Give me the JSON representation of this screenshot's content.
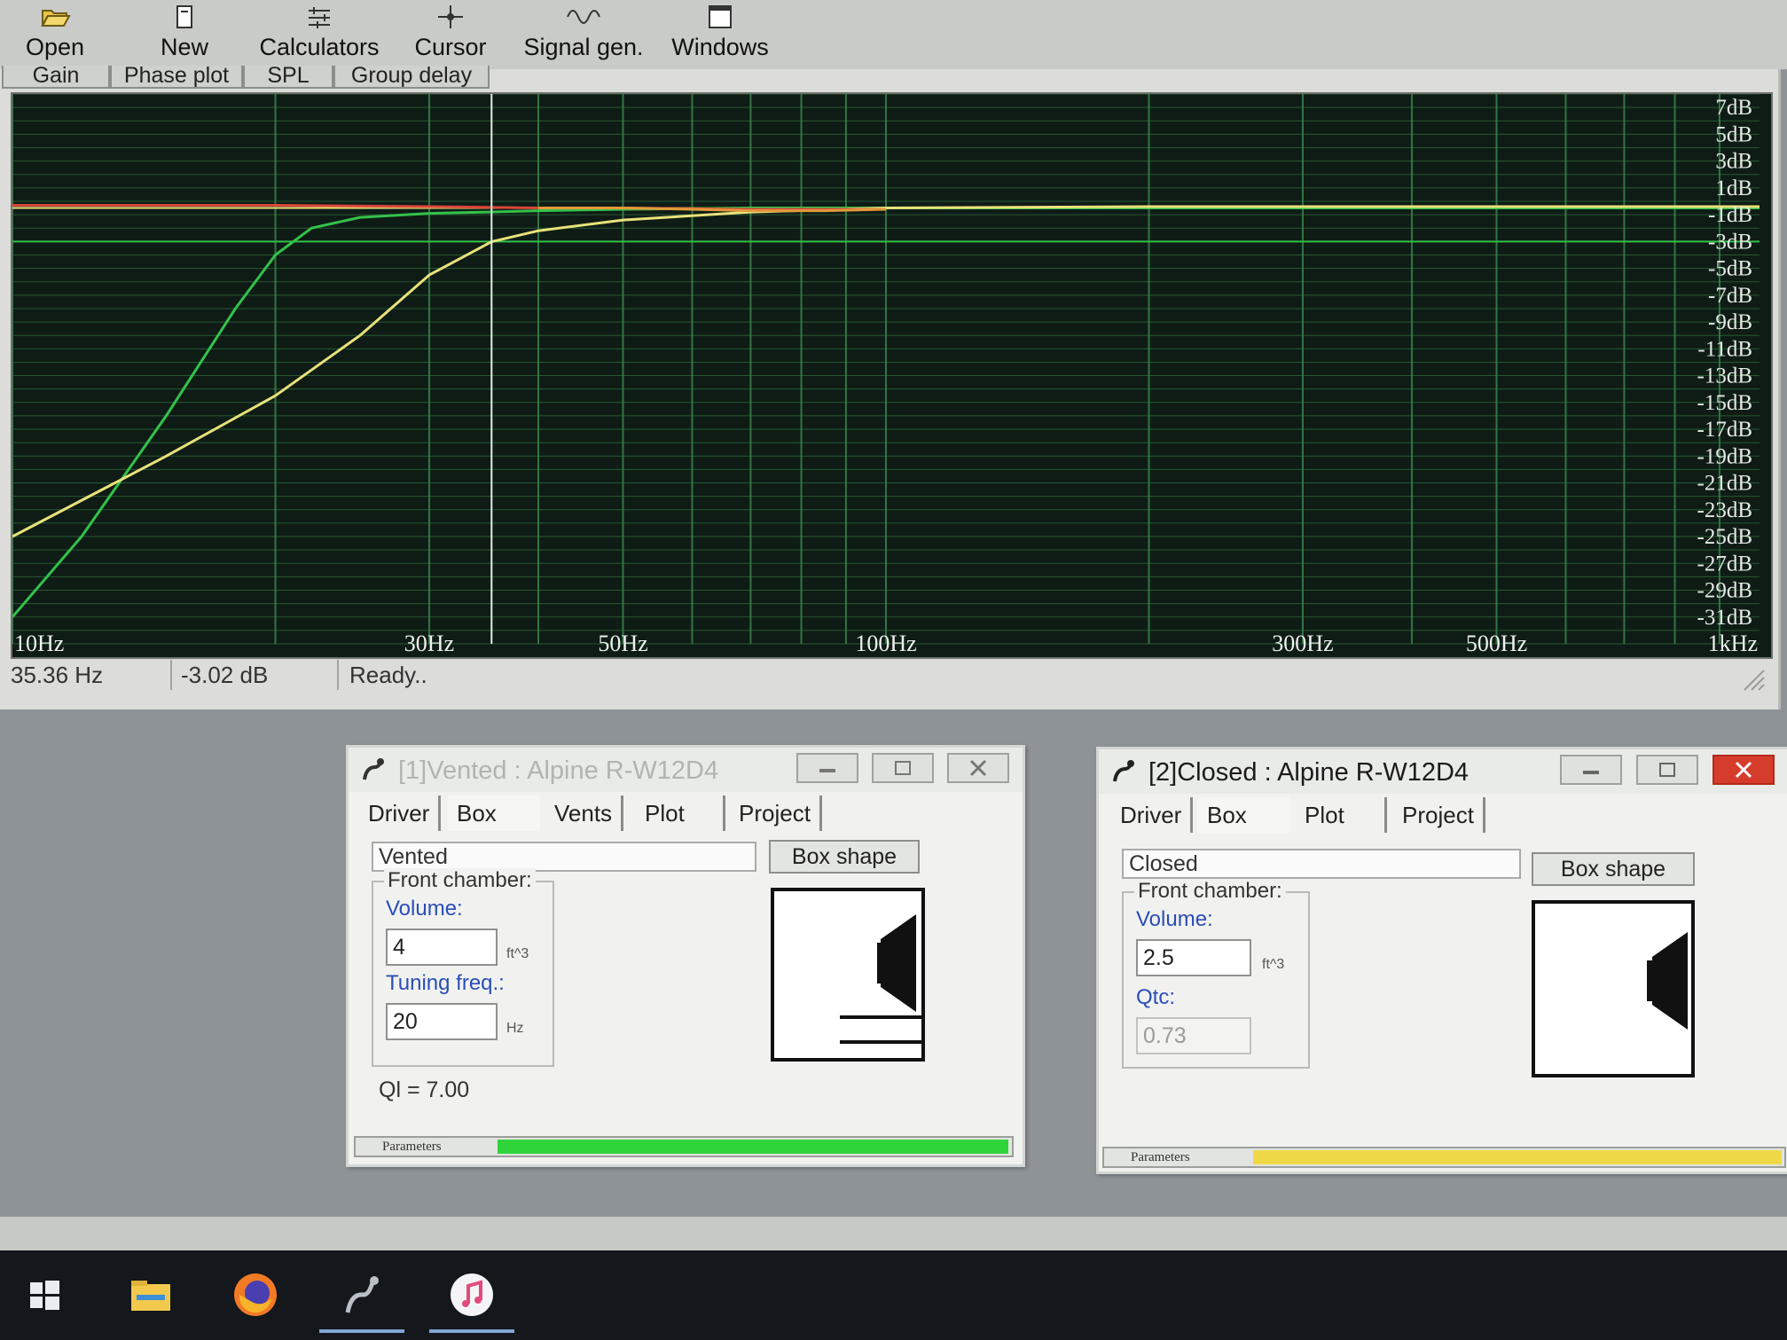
{
  "toolbar": {
    "open": "Open",
    "new": "New",
    "calculators": "Calculators",
    "cursor": "Cursor",
    "signal_gen": "Signal gen.",
    "windows": "Windows"
  },
  "plot_tabs": [
    "Gain",
    "Phase plot",
    "SPL",
    "Group delay"
  ],
  "graph": {
    "y_labels": [
      "7dB",
      "5dB",
      "3dB",
      "1dB",
      "-1dB",
      "-3dB",
      "-5dB",
      "-7dB",
      "-9dB",
      "-11dB",
      "-13dB",
      "-15dB",
      "-17dB",
      "-19dB",
      "-21dB",
      "-23dB",
      "-25dB",
      "-27dB",
      "-29dB",
      "-31dB"
    ],
    "x_labels": [
      "10Hz",
      "30Hz",
      "50Hz",
      "100Hz",
      "300Hz",
      "500Hz",
      "1kHz"
    ]
  },
  "chart_data": {
    "type": "line",
    "x_scale": "log",
    "xlim": [
      10,
      1000
    ],
    "ylim": [
      -33,
      8
    ],
    "grid": true,
    "cursor": {
      "x": 35.36
    },
    "series": [
      {
        "color": "#33c24a",
        "x": [
          10,
          12,
          15,
          18,
          20,
          22,
          25,
          30,
          35,
          40,
          50,
          70,
          100,
          200,
          1000
        ],
        "y": [
          -31,
          -25,
          -16,
          -8,
          -4,
          -2,
          -1.2,
          -0.9,
          -0.8,
          -0.7,
          -0.6,
          -0.5,
          -0.5,
          -0.5,
          -0.5
        ]
      },
      {
        "color": "#e8e27a",
        "x": [
          10,
          15,
          20,
          25,
          30,
          35.36,
          40,
          50,
          70,
          100,
          200,
          1000
        ],
        "y": [
          -25,
          -19,
          -14.5,
          -10,
          -5.5,
          -3.02,
          -2.2,
          -1.4,
          -0.8,
          -0.5,
          -0.4,
          -0.4
        ]
      },
      {
        "color": "#d9473a",
        "x": [
          10,
          20,
          30,
          40,
          50,
          70,
          100
        ],
        "y": [
          -0.3,
          -0.3,
          -0.4,
          -0.5,
          -0.5,
          -0.6,
          -0.6
        ]
      },
      {
        "color": "#e39a3a",
        "x": [
          40,
          50,
          60,
          70,
          85,
          100
        ],
        "y": [
          -0.5,
          -0.5,
          -0.6,
          -0.7,
          -0.7,
          -0.6
        ]
      }
    ],
    "reference_lines": [
      {
        "color": "#e8e27a",
        "y": -0.5
      },
      {
        "color": "#33c24a",
        "y": -3
      }
    ]
  },
  "status": {
    "freq": "35.36 Hz",
    "gain": "-3.02 dB",
    "message": "Ready.."
  },
  "win1": {
    "title": "[1]Vented : Alpine R-W12D4",
    "tabs": [
      "Driver",
      "Box",
      "Vents",
      "Plot",
      "Project"
    ],
    "box_type": "Vented",
    "box_shape_btn": "Box shape",
    "front_chamber": "Front chamber:",
    "volume_label": "Volume:",
    "volume_value": "4",
    "volume_unit": "ft^3",
    "tuning_label": "Tuning freq.:",
    "tuning_value": "20",
    "tuning_unit": "Hz",
    "ql": "Ql = 7.00",
    "params_label": "Parameters",
    "params_color": "#2fd43a",
    "params_fill": 1.0
  },
  "win2": {
    "title": "[2]Closed : Alpine R-W12D4",
    "tabs": [
      "Driver",
      "Box",
      "Plot",
      "Project"
    ],
    "box_type": "Closed",
    "box_shape_btn": "Box shape",
    "front_chamber": "Front chamber:",
    "volume_label": "Volume:",
    "volume_value": "2.5",
    "volume_unit": "ft^3",
    "qtc_label": "Qtc:",
    "qtc_value": "0.73",
    "params_label": "Parameters",
    "params_color": "#efd845",
    "params_fill": 1.0
  },
  "taskbar": {
    "icons": [
      "windows-start-icon",
      "file-explorer-icon",
      "firefox-icon",
      "winisd-icon",
      "itunes-icon"
    ]
  }
}
